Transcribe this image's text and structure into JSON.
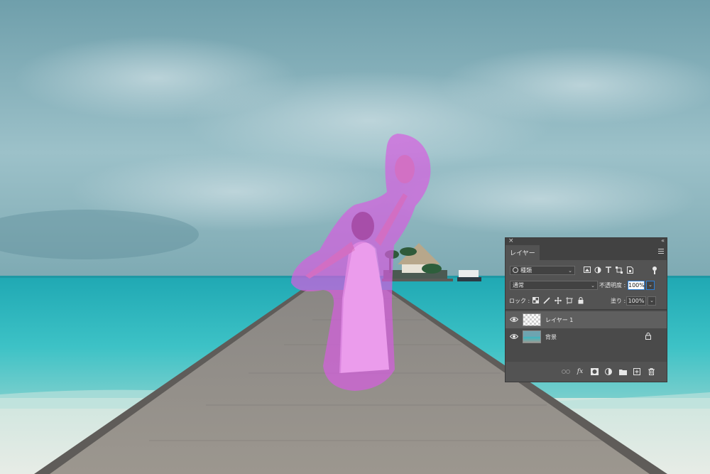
{
  "canvas": {
    "sky_color": "#6fa2ad",
    "sea_color": "#33b7bd",
    "boardwalk_color": "#8f8b86",
    "mask_overlay_color": "#e36ee8"
  },
  "panel": {
    "close_glyph": "×",
    "collapse_glyph": "«",
    "tab_label": "レイヤー",
    "filter": {
      "kind_label": "種類",
      "icons": [
        "image-filter-icon",
        "adjustment-filter-icon",
        "type-filter-icon",
        "shape-filter-icon",
        "smart-object-filter-icon"
      ]
    },
    "blend_mode": "通常",
    "opacity_label": "不透明度 :",
    "opacity_value": "100%",
    "lock_label": "ロック :",
    "fill_label": "塗り :",
    "fill_value": "100%",
    "dropdown_glyph": "⌄",
    "layers": [
      {
        "name": "レイヤー 1",
        "visible": true,
        "selected": true,
        "locked": false
      },
      {
        "name": "背景",
        "visible": true,
        "selected": false,
        "locked": true
      }
    ],
    "bottom_icons": [
      "link-layers-icon",
      "fx-icon",
      "layer-mask-icon",
      "adjustment-layer-icon",
      "group-folder-icon",
      "new-layer-icon",
      "trash-icon"
    ],
    "fx_label": "fx"
  }
}
